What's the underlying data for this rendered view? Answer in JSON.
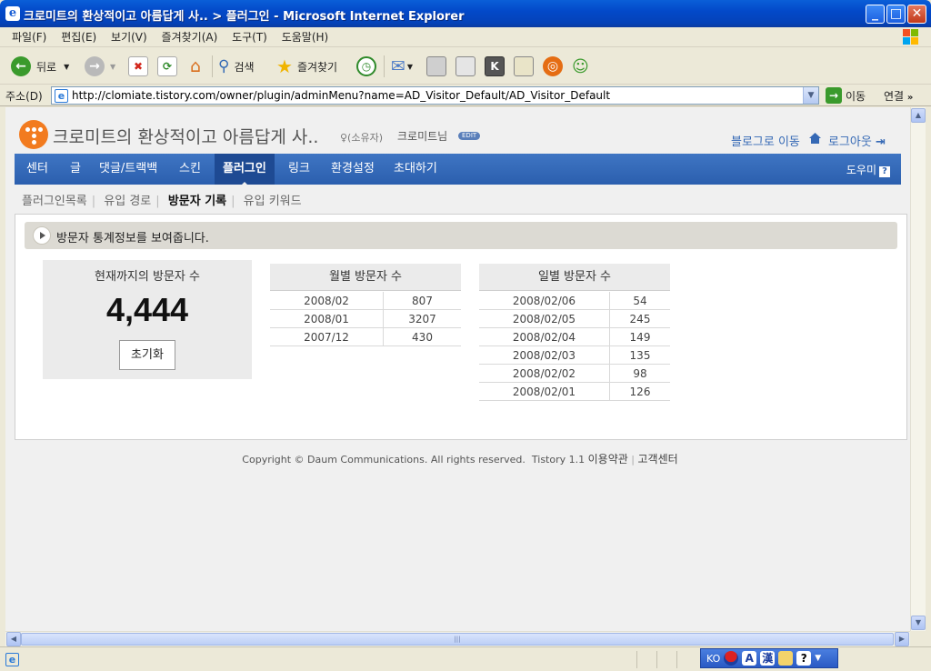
{
  "window": {
    "title": "크로미트의 환상적이고 아름답게 사.. > 플러그인 - Microsoft Internet Explorer",
    "buttons": {
      "minimize": "_",
      "maximize": "□",
      "close": "✕"
    }
  },
  "menu": [
    "파일(F)",
    "편집(E)",
    "보기(V)",
    "즐겨찾기(A)",
    "도구(T)",
    "도움말(H)"
  ],
  "toolbar": {
    "back": "뒤로",
    "search": "검색",
    "favorites": "즐겨찾기"
  },
  "address": {
    "label": "주소(D)",
    "url": "http://clomiate.tistory.com/owner/plugin/adminMenu?name=AD_Visitor_Default/AD_Visitor_Default",
    "go": "이동",
    "links": "연결"
  },
  "header": {
    "blog_title": "크로미트의 환상적이고 아름답게 사..",
    "owner": "♀(소유자)",
    "nickname": "크로미트님",
    "edit": "EDIT",
    "blog_move": "블로그로 이동",
    "logout": "로그아웃"
  },
  "nav": {
    "items": [
      "센터",
      "글",
      "댓글/트랙백",
      "스킨",
      "플러그인",
      "링크",
      "환경설정",
      "초대하기"
    ],
    "active_index": 4,
    "help": "도우미"
  },
  "subnav": {
    "items": [
      "플러그인목록",
      "유입 경로",
      "방문자 기록",
      "유입 키워드"
    ],
    "active_index": 2
  },
  "info": "방문자 통계정보를 보여줍니다.",
  "total": {
    "caption": "현재까지의 방문자 수",
    "value": "4,444",
    "reset": "초기화"
  },
  "monthly": {
    "title": "월별 방문자 수",
    "rows": [
      {
        "date": "2008/02",
        "count": "807"
      },
      {
        "date": "2008/01",
        "count": "3207"
      },
      {
        "date": "2007/12",
        "count": "430"
      }
    ]
  },
  "daily": {
    "title": "일별 방문자 수",
    "rows": [
      {
        "date": "2008/02/06",
        "count": "54"
      },
      {
        "date": "2008/02/05",
        "count": "245"
      },
      {
        "date": "2008/02/04",
        "count": "149"
      },
      {
        "date": "2008/02/03",
        "count": "135"
      },
      {
        "date": "2008/02/02",
        "count": "98"
      },
      {
        "date": "2008/02/01",
        "count": "126"
      }
    ]
  },
  "footer": {
    "copyright": "Copyright © Daum Communications. All rights reserved.",
    "version": "Tistory 1.1",
    "terms": "이용약관",
    "support": "고객센터"
  },
  "langbar": {
    "lang": "KO",
    "mode": "A",
    "hanja": "漢"
  },
  "colors": {
    "nav": "#2b5fae",
    "nav_active": "#1e4a93",
    "logo": "#f27b1f",
    "link": "#3569b5"
  }
}
